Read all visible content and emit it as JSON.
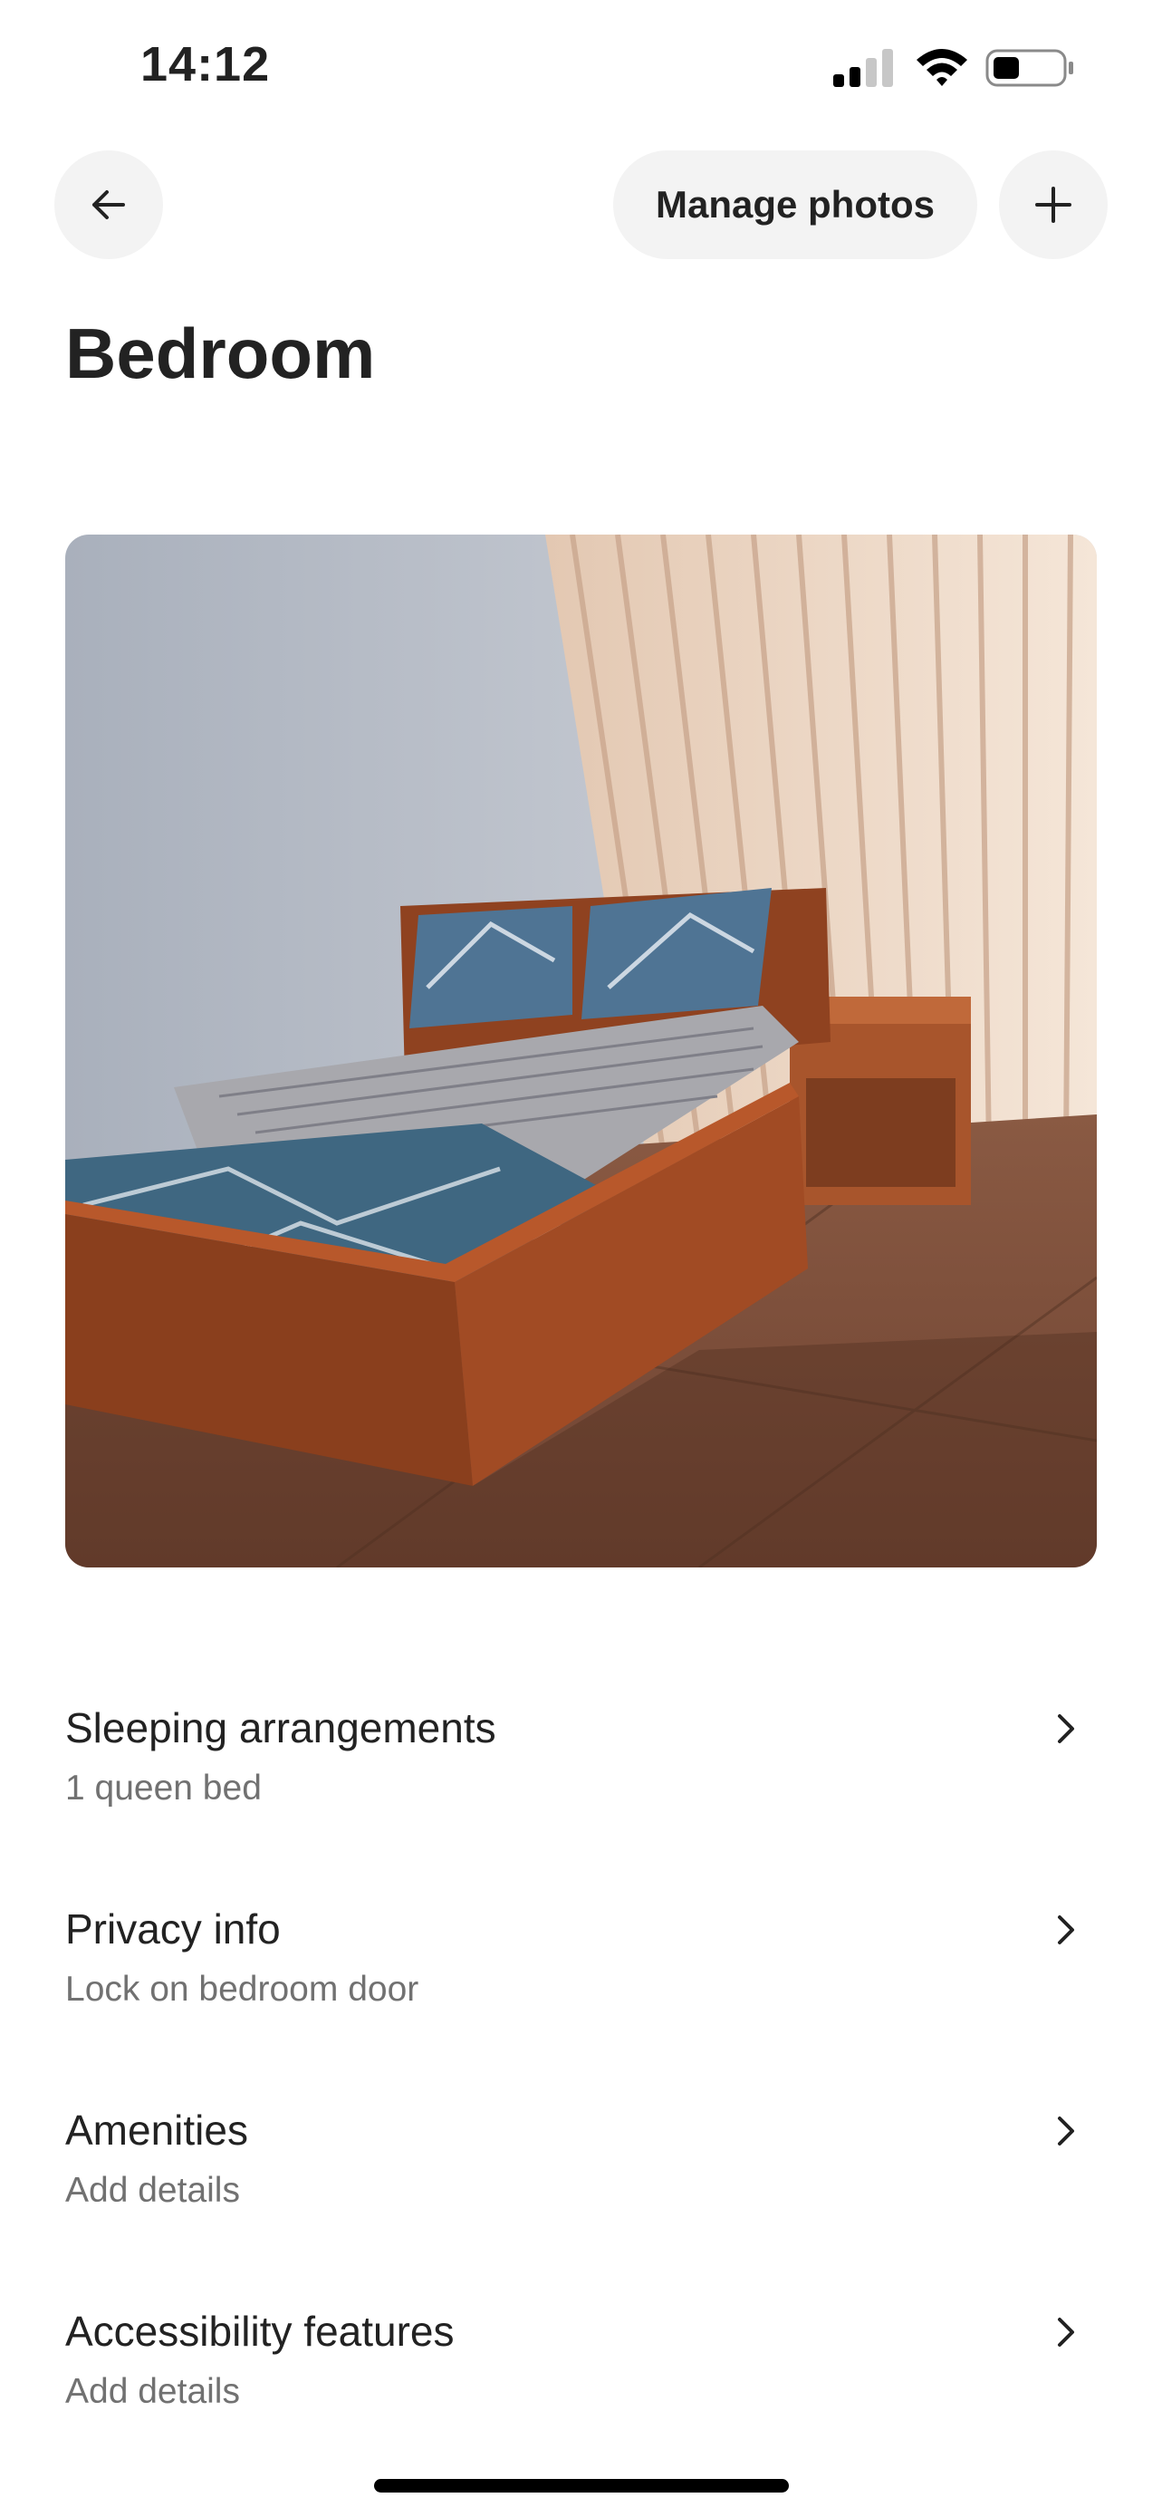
{
  "status_bar": {
    "time": "14:12",
    "signal_icon": "cellular-signal-icon",
    "wifi_icon": "wifi-icon",
    "battery_icon": "battery-icon",
    "battery_level": 0.35
  },
  "header": {
    "back_icon": "arrow-left-icon",
    "manage_photos_label": "Manage photos",
    "add_icon": "plus-icon"
  },
  "page": {
    "title": "Bedroom"
  },
  "photo": {
    "description_icon": "bedroom-photo"
  },
  "details": [
    {
      "title": "Sleeping arrangements",
      "subtitle": "1 queen bed"
    },
    {
      "title": "Privacy info",
      "subtitle": "Lock on bedroom door"
    },
    {
      "title": "Amenities",
      "subtitle": "Add details"
    },
    {
      "title": "Accessibility features",
      "subtitle": "Add details"
    }
  ],
  "colors": {
    "text": "#222222",
    "subtext": "#717171",
    "button_bg": "#f3f3f3"
  }
}
